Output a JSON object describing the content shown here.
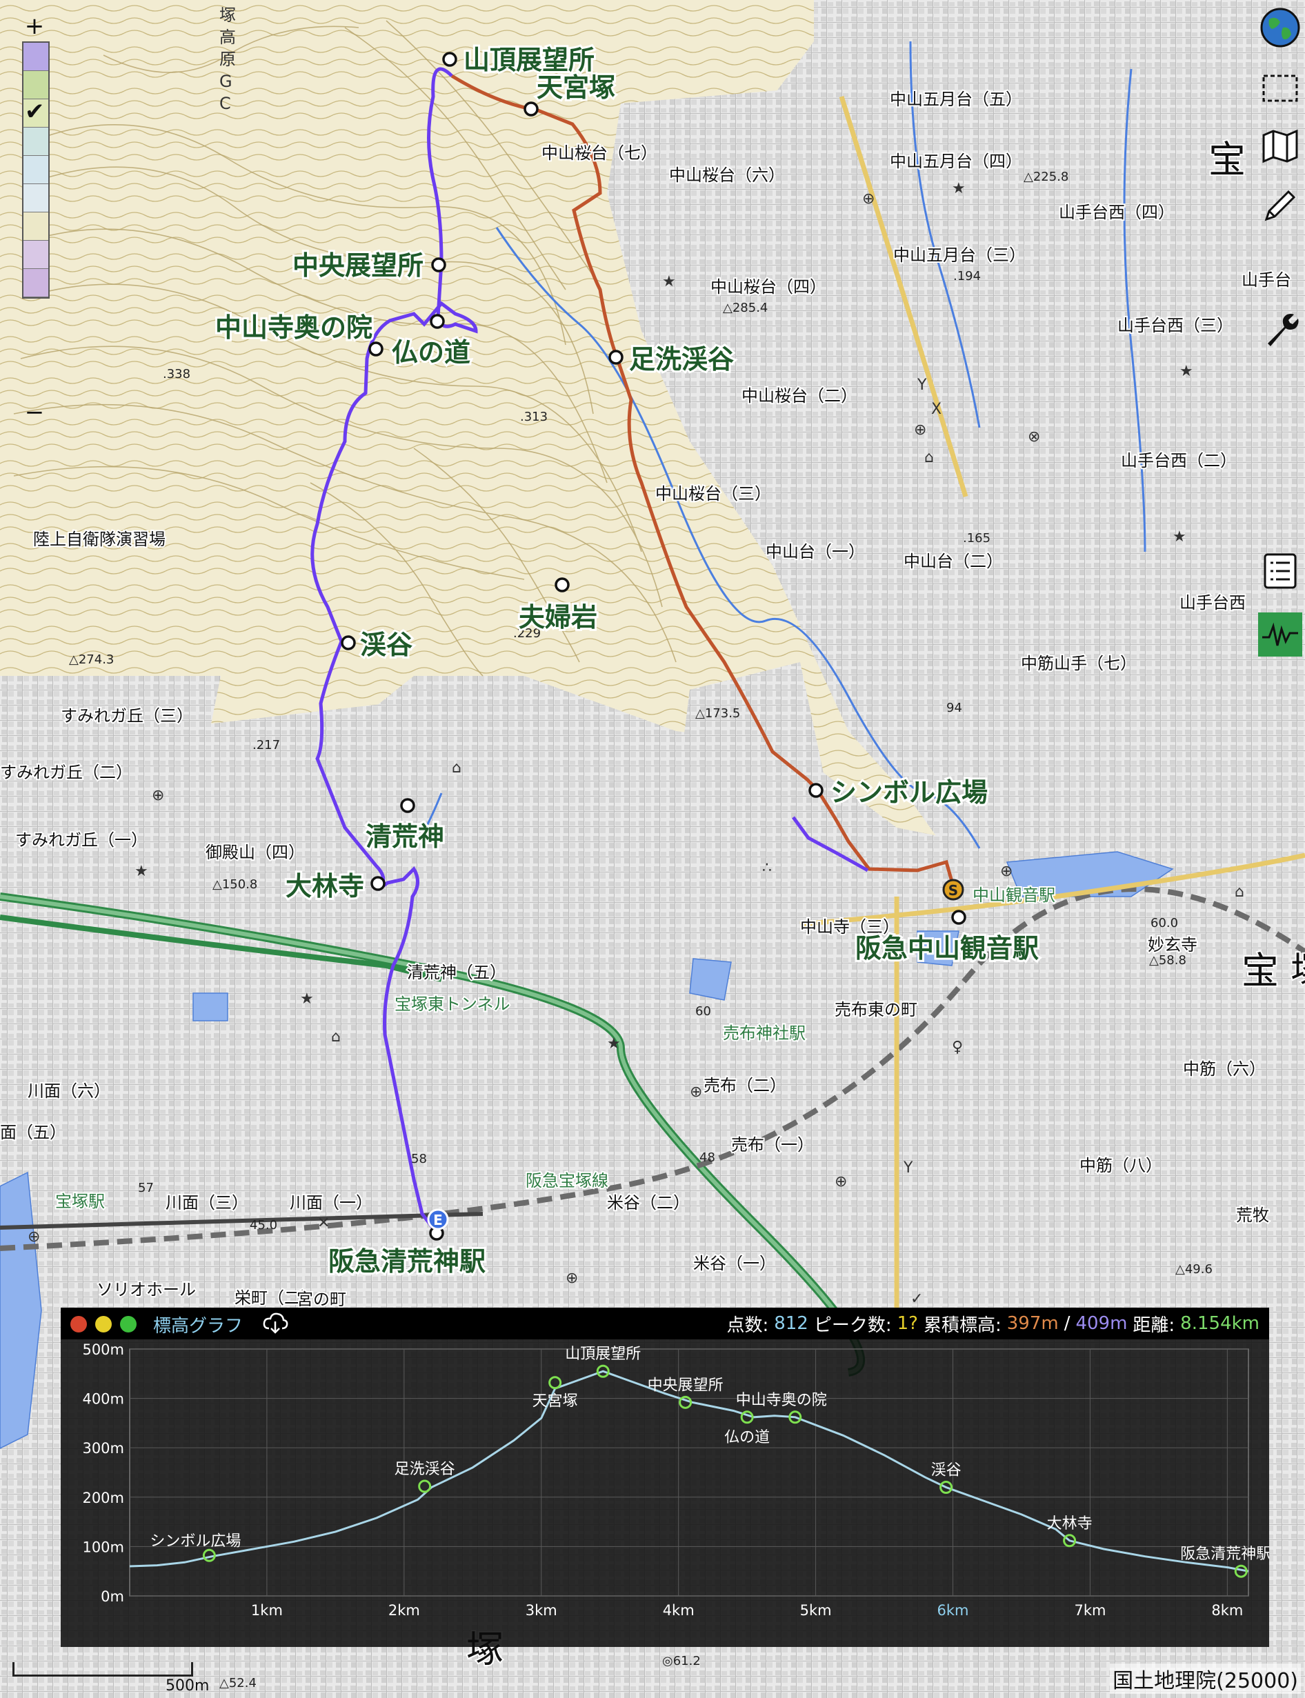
{
  "map": {
    "route_labels": [
      {
        "text": "山頂展望所",
        "key": "sancho"
      },
      {
        "text": "天宮塚",
        "key": "tengu"
      },
      {
        "text": "中央展望所",
        "key": "chuo"
      },
      {
        "text": "中山寺奥の院",
        "key": "okunoin"
      },
      {
        "text": "仏の道",
        "key": "hotoke"
      },
      {
        "text": "足洗渓谷",
        "key": "ashiarai"
      },
      {
        "text": "夫婦岩",
        "key": "meoto"
      },
      {
        "text": "渓谷",
        "key": "keikoku"
      },
      {
        "text": "清荒神",
        "key": "kiyoshikojin"
      },
      {
        "text": "大林寺",
        "key": "dairinji"
      },
      {
        "text": "シンボル広場",
        "key": "symbol"
      },
      {
        "text": "阪急中山観音駅",
        "key": "nakayama"
      },
      {
        "text": "阪急清荒神駅",
        "key": "kiyoshi_sta"
      }
    ],
    "place_labels": [
      {
        "text": "中山五月台（五）"
      },
      {
        "text": "中山桜台（七）"
      },
      {
        "text": "中山桜台（六）"
      },
      {
        "text": "中山五月台（四）"
      },
      {
        "text": "山手台西（四）"
      },
      {
        "text": "中山五月台（三）"
      },
      {
        "text": "中山桜台（四）"
      },
      {
        "text": "山手台"
      },
      {
        "text": "山手台西（三）"
      },
      {
        "text": "中山桜台（二）"
      },
      {
        "text": "山手台西（二）"
      },
      {
        "text": "中山桜台（三）"
      },
      {
        "text": "中山台（一）"
      },
      {
        "text": "中山台（二）"
      },
      {
        "text": "陸上自衛隊演習場"
      },
      {
        "text": "山手台西"
      },
      {
        "text": "すみれガ丘（三）"
      },
      {
        "text": "中筋山手（七）"
      },
      {
        "text": "すみれガ丘（二）"
      },
      {
        "text": "すみれガ丘（一）"
      },
      {
        "text": "御殿山（四）"
      },
      {
        "text": "清荒神（五）"
      },
      {
        "text": "宝塚東トンネル"
      },
      {
        "text": "売布東の町"
      },
      {
        "text": "売布神社駅"
      },
      {
        "text": "中山寺（三）"
      },
      {
        "text": "中山観音駅"
      },
      {
        "text": "川面（六）"
      },
      {
        "text": "面（五）"
      },
      {
        "text": "売布（二）"
      },
      {
        "text": "売布（一）"
      },
      {
        "text": "中筋（六）"
      },
      {
        "text": "中筋（八）"
      },
      {
        "text": "阪急宝塚線"
      },
      {
        "text": "宝塚駅"
      },
      {
        "text": "川面（三）"
      },
      {
        "text": "川面（一）"
      },
      {
        "text": "米谷（二）"
      },
      {
        "text": "米谷（一）"
      },
      {
        "text": "ソリオホール"
      },
      {
        "text": "栄町（二）"
      },
      {
        "text": "宮の町"
      },
      {
        "text": "荒牧"
      },
      {
        "text": "宝"
      },
      {
        "text": "塚"
      },
      {
        "text": "宝 塚"
      },
      {
        "text": "妙玄寺"
      }
    ],
    "spot_heights": [
      {
        "text": "△225.8"
      },
      {
        "text": "△285.4"
      },
      {
        "text": ".194"
      },
      {
        "text": ".338"
      },
      {
        "text": ".313"
      },
      {
        "text": ".229"
      },
      {
        "text": "△274.3"
      },
      {
        "text": "△173.5"
      },
      {
        "text": ".165"
      },
      {
        "text": ".217"
      },
      {
        "text": "94"
      },
      {
        "text": "△150.8"
      },
      {
        "text": "60.0"
      },
      {
        "text": "△58.8"
      },
      {
        "text": "60"
      },
      {
        "text": "58"
      },
      {
        "text": "48"
      },
      {
        "text": "57"
      },
      {
        "text": "45.0"
      },
      {
        "text": "△49.6"
      },
      {
        "text": "△52.4"
      },
      {
        "text": "◎61.2"
      }
    ],
    "left_labels": [
      {
        "text": "塚高原GC"
      }
    ],
    "scale_label": "500m",
    "credit": "国土地理院(25000)",
    "start_marker": "S",
    "end_marker": "E",
    "colors": {
      "route_blue": "#6a3cf0",
      "route_orange": "#c0542c",
      "water": "#7aa3e6",
      "contour": "#b9a76a",
      "rail": "#3e9b58"
    }
  },
  "controls": {
    "zoom_in": "+",
    "zoom_out": "−",
    "tools": [
      "globe-icon",
      "select-rect-icon",
      "map-icon",
      "pencil-icon",
      "wrench-icon",
      "list-icon",
      "elevation-graph-icon"
    ]
  },
  "elevation_panel": {
    "title": "標高グラフ",
    "stats": {
      "points_label": "点数:",
      "points_value": "812",
      "peaks_label": "ピーク数:",
      "peaks_value": "1?",
      "gain_label": "累積標高:",
      "ascent": "397m",
      "slash": "/",
      "descent": "409m",
      "dist_label": "距離:",
      "dist_value": "8.154km"
    }
  },
  "chart_data": {
    "type": "area",
    "xlabel": "",
    "ylabel": "",
    "ylim": [
      0,
      500
    ],
    "xlim": [
      0,
      8.154
    ],
    "y_ticks": [
      "0m",
      "100m",
      "200m",
      "300m",
      "400m",
      "500m"
    ],
    "x_ticks": [
      "1km",
      "2km",
      "3km",
      "4km",
      "5km",
      "6km",
      "7km",
      "8km"
    ],
    "grid": true,
    "profile": [
      [
        0,
        60
      ],
      [
        0.2,
        62
      ],
      [
        0.4,
        68
      ],
      [
        0.6,
        80
      ],
      [
        0.9,
        95
      ],
      [
        1.2,
        110
      ],
      [
        1.5,
        130
      ],
      [
        1.8,
        158
      ],
      [
        2.1,
        195
      ],
      [
        2.2,
        220
      ],
      [
        2.5,
        260
      ],
      [
        2.8,
        315
      ],
      [
        3.0,
        360
      ],
      [
        3.1,
        420
      ],
      [
        3.3,
        440
      ],
      [
        3.45,
        455
      ],
      [
        3.6,
        440
      ],
      [
        3.9,
        410
      ],
      [
        4.1,
        392
      ],
      [
        4.4,
        375
      ],
      [
        4.55,
        362
      ],
      [
        4.7,
        365
      ],
      [
        4.85,
        362
      ],
      [
        5.2,
        325
      ],
      [
        5.5,
        285
      ],
      [
        5.8,
        240
      ],
      [
        5.95,
        220
      ],
      [
        6.2,
        195
      ],
      [
        6.5,
        165
      ],
      [
        6.75,
        135
      ],
      [
        6.85,
        112
      ],
      [
        7.1,
        95
      ],
      [
        7.4,
        80
      ],
      [
        7.7,
        68
      ],
      [
        8.0,
        58
      ],
      [
        8.154,
        50
      ]
    ],
    "waypoints": [
      {
        "name": "シンボル広場",
        "x": 0.58,
        "y": 82
      },
      {
        "name": "足洗渓谷",
        "x": 2.15,
        "y": 222
      },
      {
        "name": "天宮塚",
        "x": 3.1,
        "y": 432
      },
      {
        "name": "山頂展望所",
        "x": 3.45,
        "y": 455
      },
      {
        "name": "中央展望所",
        "x": 4.05,
        "y": 392
      },
      {
        "name": "仏の道",
        "x": 4.5,
        "y": 362
      },
      {
        "name": "中山寺奥の院",
        "x": 4.85,
        "y": 362
      },
      {
        "name": "渓谷",
        "x": 5.95,
        "y": 220
      },
      {
        "name": "大林寺",
        "x": 6.85,
        "y": 112
      },
      {
        "name": "阪急清荒神駅",
        "x": 8.1,
        "y": 50
      }
    ]
  }
}
